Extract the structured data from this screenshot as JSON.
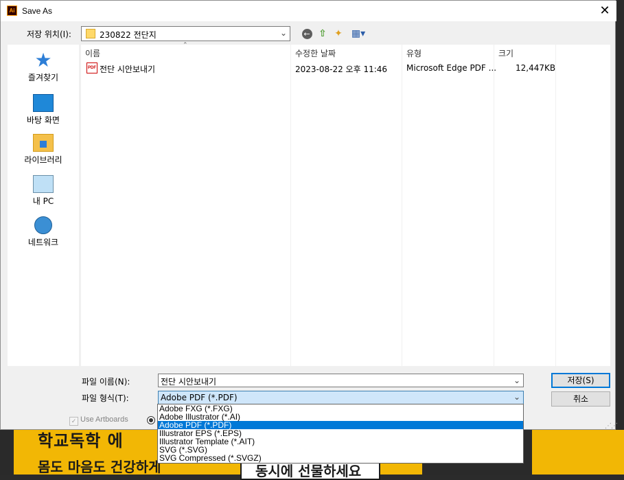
{
  "window": {
    "title": "Save As",
    "app_icon_text": "Ai"
  },
  "location": {
    "label": "저장 위치(I):",
    "value": "230822 전단지"
  },
  "sidebar": {
    "items": [
      {
        "label": "즐겨찾기",
        "icon": "star-icon"
      },
      {
        "label": "바탕 화면",
        "icon": "desktop-icon"
      },
      {
        "label": "라이브러리",
        "icon": "library-icon"
      },
      {
        "label": "내 PC",
        "icon": "computer-icon"
      },
      {
        "label": "네트워크",
        "icon": "network-icon"
      }
    ]
  },
  "filelist": {
    "columns": [
      "이름",
      "수정한 날짜",
      "유형",
      "크기"
    ],
    "rows": [
      {
        "name": "전단 시안보내기",
        "date": "2023-08-22 오후 11:46",
        "type": "Microsoft Edge PDF ...",
        "size": "12,447KB",
        "icon": "pdf-file-icon",
        "icon_text": "PDF"
      }
    ]
  },
  "filename": {
    "label": "파일 이름(N):",
    "value": "전단 시안보내기"
  },
  "filetype": {
    "label": "파일 형식(T):",
    "value": "Adobe PDF (*.PDF)",
    "options": [
      "Adobe FXG (*.FXG)",
      "Adobe Illustrator (*.AI)",
      "Adobe PDF (*.PDF)",
      "Illustrator EPS (*.EPS)",
      "Illustrator Template (*.AIT)",
      "SVG (*.SVG)",
      "SVG Compressed (*.SVGZ)"
    ],
    "selected_index": 2
  },
  "buttons": {
    "save": "저장(S)",
    "cancel": "취소"
  },
  "options": {
    "use_artboards": "Use Artboards"
  },
  "background": {
    "line1": "학교독학 에",
    "line2": "몸도 마음도 건강하게",
    "box_text": "동시에 선물하세요"
  },
  "colors": {
    "accent": "#0078d7",
    "combo_highlight": "#cfe6fa",
    "poster_yellow": "#f2b705"
  }
}
